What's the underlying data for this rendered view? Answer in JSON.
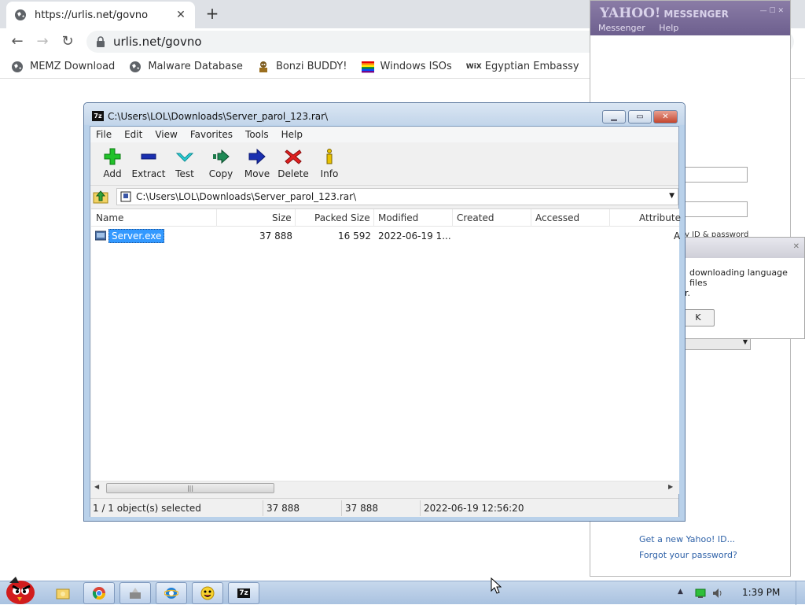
{
  "browser": {
    "tab_title": "https://urlis.net/govno",
    "address": "urlis.net/govno",
    "bookmarks": [
      {
        "label": "MEMZ Download",
        "icon": "globe-icon"
      },
      {
        "label": "Malware Database",
        "icon": "globe-icon"
      },
      {
        "label": "Bonzi BUDDY!",
        "icon": "bonzi-icon"
      },
      {
        "label": "Windows ISOs",
        "icon": "rainbow-flag-icon"
      },
      {
        "label": "Egyptian Embassy",
        "icon": "wix-icon"
      }
    ]
  },
  "yahoo": {
    "logo": "YAHOO!",
    "logo_sub": "MESSENGER",
    "menu": [
      "Messenger",
      "Help"
    ],
    "id_hint": "y ID & password",
    "link_new_id": "Get a new Yahoo! ID...",
    "link_forgot": "Forgot your password?",
    "dialog_msg": "downloading language files",
    "dialog_msg2": "r.",
    "dialog_ok": "K"
  },
  "zip": {
    "title": "C:\\Users\\LOL\\Downloads\\Server_parol_123.rar\\",
    "menu": [
      "File",
      "Edit",
      "View",
      "Favorites",
      "Tools",
      "Help"
    ],
    "toolbar": [
      "Add",
      "Extract",
      "Test",
      "Copy",
      "Move",
      "Delete",
      "Info"
    ],
    "path": "C:\\Users\\LOL\\Downloads\\Server_parol_123.rar\\",
    "columns": [
      "Name",
      "Size",
      "Packed Size",
      "Modified",
      "Created",
      "Accessed",
      "Attribute"
    ],
    "rows": [
      {
        "name": "Server.exe",
        "size": "37 888",
        "packed": "16 592",
        "modified": "2022-06-19 1...",
        "created": "",
        "accessed": "",
        "attr": "A"
      }
    ],
    "status": {
      "selected": "1 / 1 object(s) selected",
      "size": "37 888",
      "packed": "37 888",
      "date": "2022-06-19 12:56:20"
    }
  },
  "taskbar": {
    "clock": "1:39 PM"
  }
}
